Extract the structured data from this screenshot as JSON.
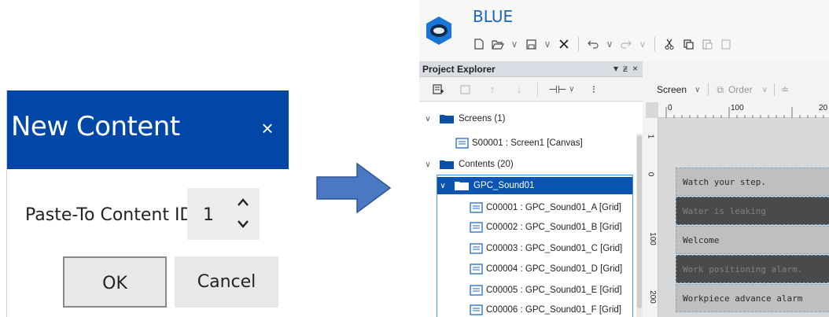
{
  "dialog": {
    "title": "New Content",
    "close_glyph": "×",
    "field_label": "Paste-To Content ID",
    "field_value": "1",
    "ok_label": "OK",
    "cancel_label": "Cancel",
    "title_bar_color": "#0047a8"
  },
  "app": {
    "name": "BLUE",
    "accent_color": "#1d63c9",
    "toolbar_icons": [
      "new-file-icon",
      "open-folder-icon",
      "save-icon",
      "close-icon",
      "undo-icon",
      "redo-icon",
      "cut-icon",
      "copy-icon",
      "paste-icon"
    ]
  },
  "project_explorer": {
    "title": "Project Explorer",
    "pin_glyph": "▾ ⊥",
    "close_glyph": "×",
    "tree": {
      "screens_label": "Screens (1)",
      "screen_item": "S00001 : Screen1 [Canvas]",
      "contents_label": "Contents (20)",
      "group_label": "GPC_Sound01",
      "items": [
        "C00001 : GPC_Sound01_A [Grid]",
        "C00002 : GPC_Sound01_B [Grid]",
        "C00003 : GPC_Sound01_C [Grid]",
        "C00004 : GPC_Sound01_D [Grid]",
        "C00005 : GPC_Sound01_E [Grid]",
        "C00006 : GPC_Sound01_F [Grid]"
      ]
    }
  },
  "editor": {
    "screen_dropdown": "Screen",
    "order_label": "Order",
    "ruler_top": [
      "0",
      "100",
      "20"
    ],
    "ruler_left": [
      "1",
      "0",
      "100",
      "200"
    ],
    "canvas_rows": [
      {
        "text": "Watch your step.",
        "style": "light"
      },
      {
        "text": "Water is leaking",
        "style": "dark"
      },
      {
        "text": "Welcome",
        "style": "light"
      },
      {
        "text": "Work positioning alarm.",
        "style": "dark"
      },
      {
        "text": "Workpiece advance alarm",
        "style": "light"
      }
    ]
  }
}
